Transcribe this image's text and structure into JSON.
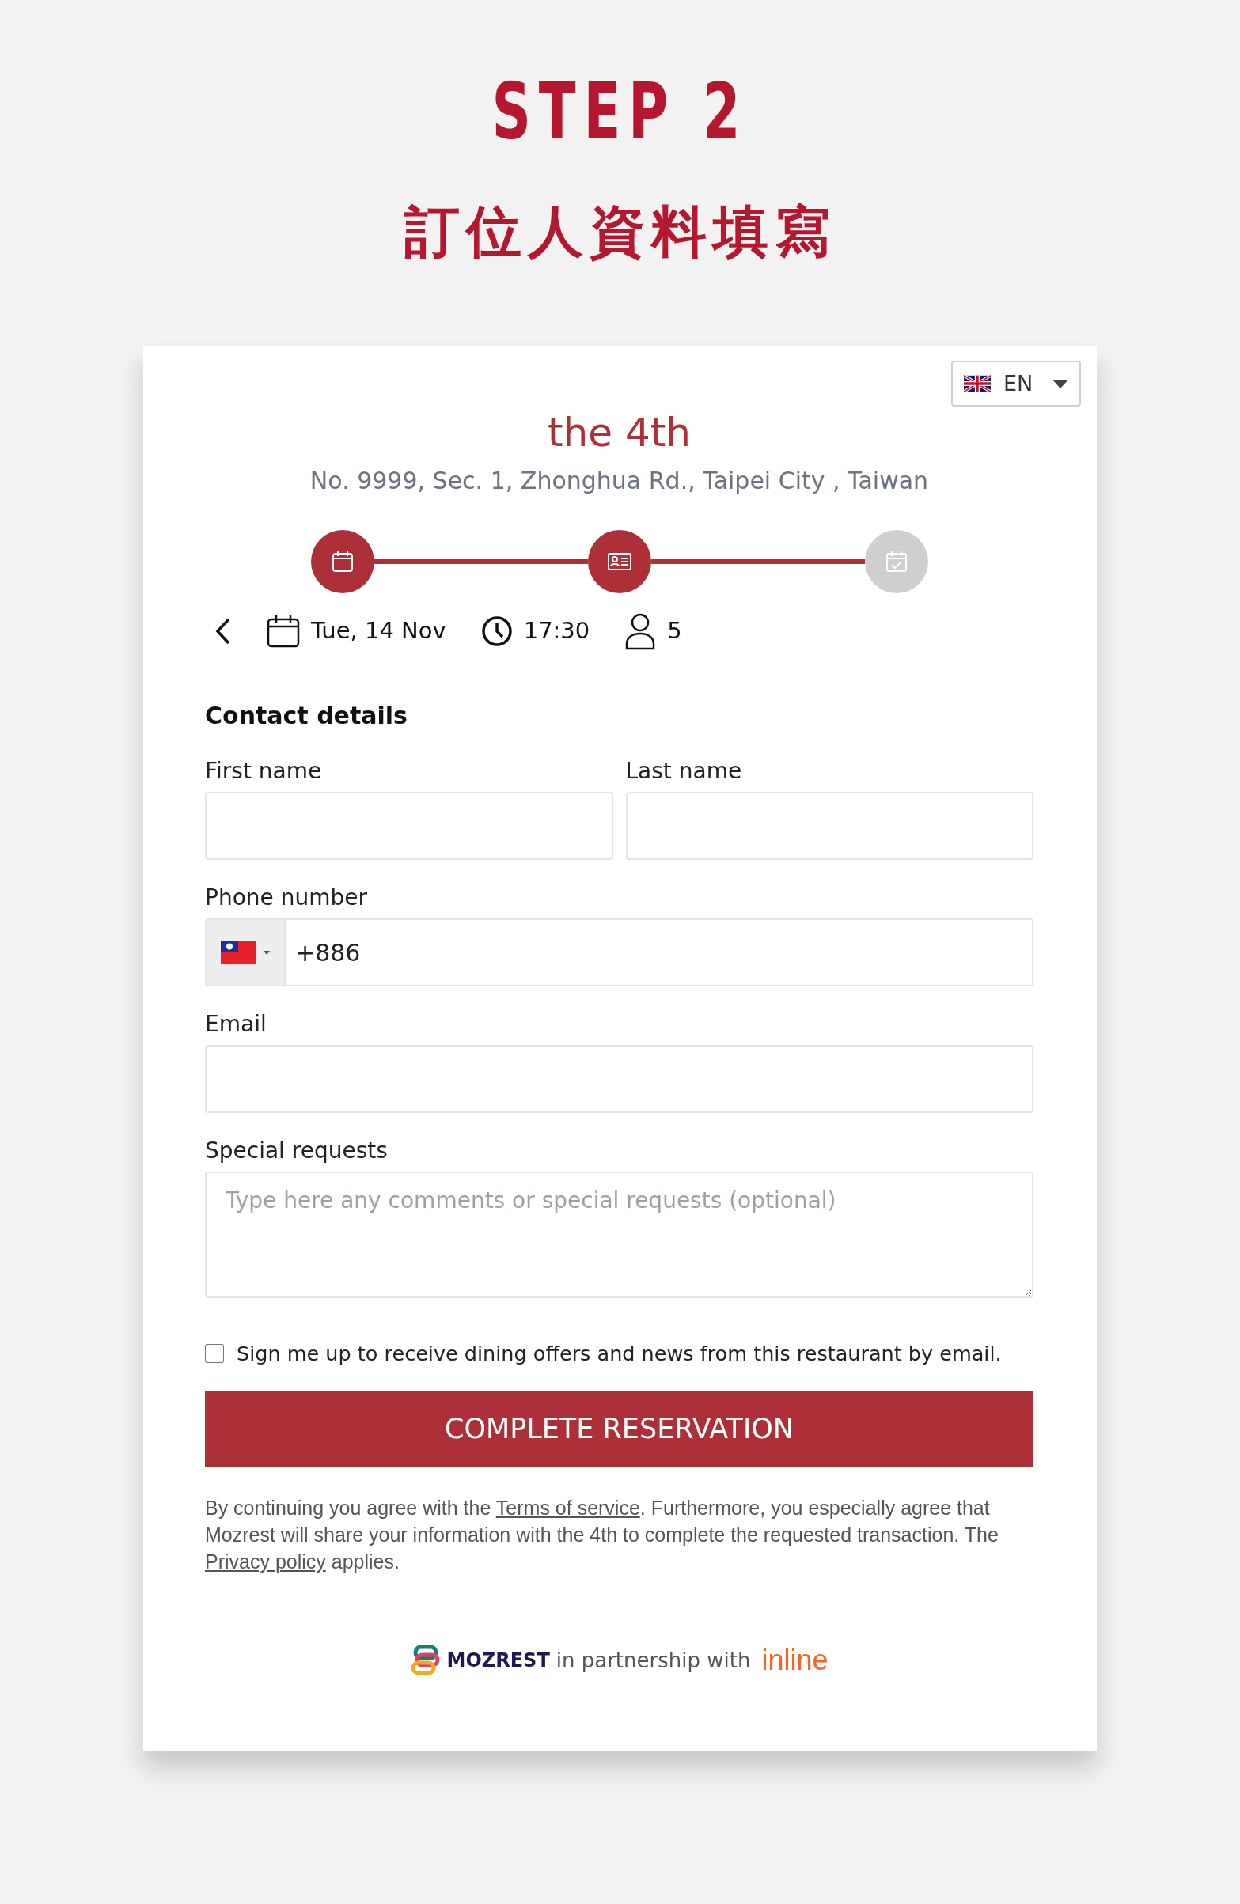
{
  "header": {
    "step": "STEP 2",
    "subtitle": "訂位人資料填寫"
  },
  "language": {
    "code": "EN"
  },
  "restaurant": {
    "name": "the 4th",
    "address": "No. 9999, Sec. 1, Zhonghua Rd., Taipei City , Taiwan"
  },
  "steps": [
    {
      "completed": true
    },
    {
      "completed": true
    },
    {
      "completed": false
    }
  ],
  "booking": {
    "date": "Tue, 14 Nov",
    "time": "17:30",
    "guests": "5"
  },
  "form": {
    "title": "Contact details",
    "first_name": {
      "label": "First name"
    },
    "last_name": {
      "label": "Last name"
    },
    "phone": {
      "label": "Phone number",
      "value": "+886"
    },
    "email": {
      "label": "Email"
    },
    "requests": {
      "label": "Special requests",
      "placeholder": "Type here any comments or special requests (optional)"
    },
    "newsletter": {
      "label": "Sign me up to receive dining offers and news from this restaurant by email.",
      "checked": false
    },
    "submit": "COMPLETE RESERVATION"
  },
  "legal": [
    {
      "kind": "text",
      "text": "By continuing you agree with the "
    },
    {
      "kind": "link",
      "text": "Terms of service"
    },
    {
      "kind": "text",
      "text": ". Furthermore, you especially agree that Mozrest will share your information with the 4th to complete the requested transaction. The "
    },
    {
      "kind": "link",
      "text": "Privacy policy"
    },
    {
      "kind": "text",
      "text": " applies."
    }
  ],
  "footer": {
    "brand": "MOZREST",
    "text": "in partnership with",
    "partner": "inline"
  }
}
